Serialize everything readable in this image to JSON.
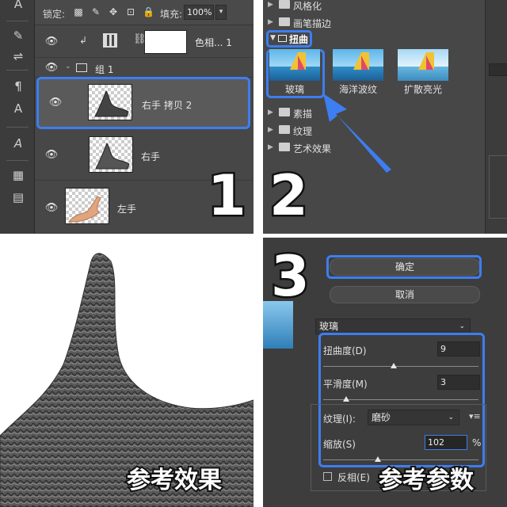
{
  "panel1": {
    "lock_label": "锁定:",
    "fill_label": "填充:",
    "fill_value": "100%",
    "layers": [
      {
        "name": "色相... 1",
        "kind": "adjustment"
      },
      {
        "name": "组 1",
        "kind": "group"
      },
      {
        "name": "右手 拷贝 2",
        "kind": "selected"
      },
      {
        "name": "右手",
        "kind": "layer"
      },
      {
        "name": "左手",
        "kind": "layer"
      }
    ],
    "step_numbers": [
      "1",
      "2",
      "3"
    ]
  },
  "panel2": {
    "folders_top": [
      "风格化",
      "画笔描边"
    ],
    "active_folder": "扭曲",
    "filters": [
      "玻璃",
      "海洋波纹",
      "扩散亮光"
    ],
    "folders_bottom": [
      "素描",
      "纹理",
      "艺术效果"
    ]
  },
  "panel3": {
    "caption": "参考效果"
  },
  "panel4": {
    "ok_button": "确定",
    "cancel_button": "取消",
    "filter_select": "玻璃",
    "params": {
      "distortion_label": "扭曲度(D)",
      "distortion_value": "9",
      "smoothness_label": "平滑度(M)",
      "smoothness_value": "3",
      "texture_label": "纹理(I):",
      "texture_value": "磨砂",
      "scale_label": "缩放(S)",
      "scale_value": "102",
      "scale_unit": "%",
      "invert_label": "反相(E)"
    },
    "caption": "参考参数"
  },
  "colors": {
    "highlight": "#3d7ef0",
    "panel_bg": "#474747"
  }
}
